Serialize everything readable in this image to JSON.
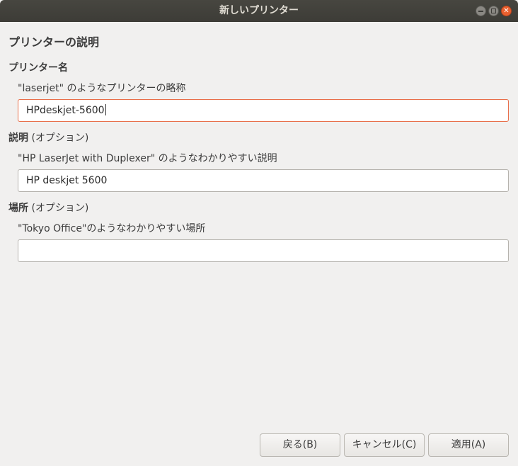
{
  "window": {
    "title": "新しいプリンター"
  },
  "page_title": "プリンターの説明",
  "printer_name": {
    "label": "プリンター名",
    "hint": "\"laserjet\" のようなプリンターの略称",
    "value": "HPdeskjet-5600"
  },
  "description": {
    "label_main": "説明",
    "label_optional": " (オプション)",
    "hint": "\"HP LaserJet with Duplexer\" のようなわかりやすい説明",
    "value": "HP deskjet 5600"
  },
  "location": {
    "label_main": "場所",
    "label_optional": " (オプション)",
    "hint": "\"Tokyo Office\"のようなわかりやすい場所",
    "value": ""
  },
  "buttons": {
    "back": "戻る(B)",
    "cancel": "キャンセル(C)",
    "apply": "適用(A)"
  },
  "colors": {
    "titlebar": "#3d3c37",
    "focus_border": "#e86f4a",
    "close_button": "#e9602f"
  }
}
